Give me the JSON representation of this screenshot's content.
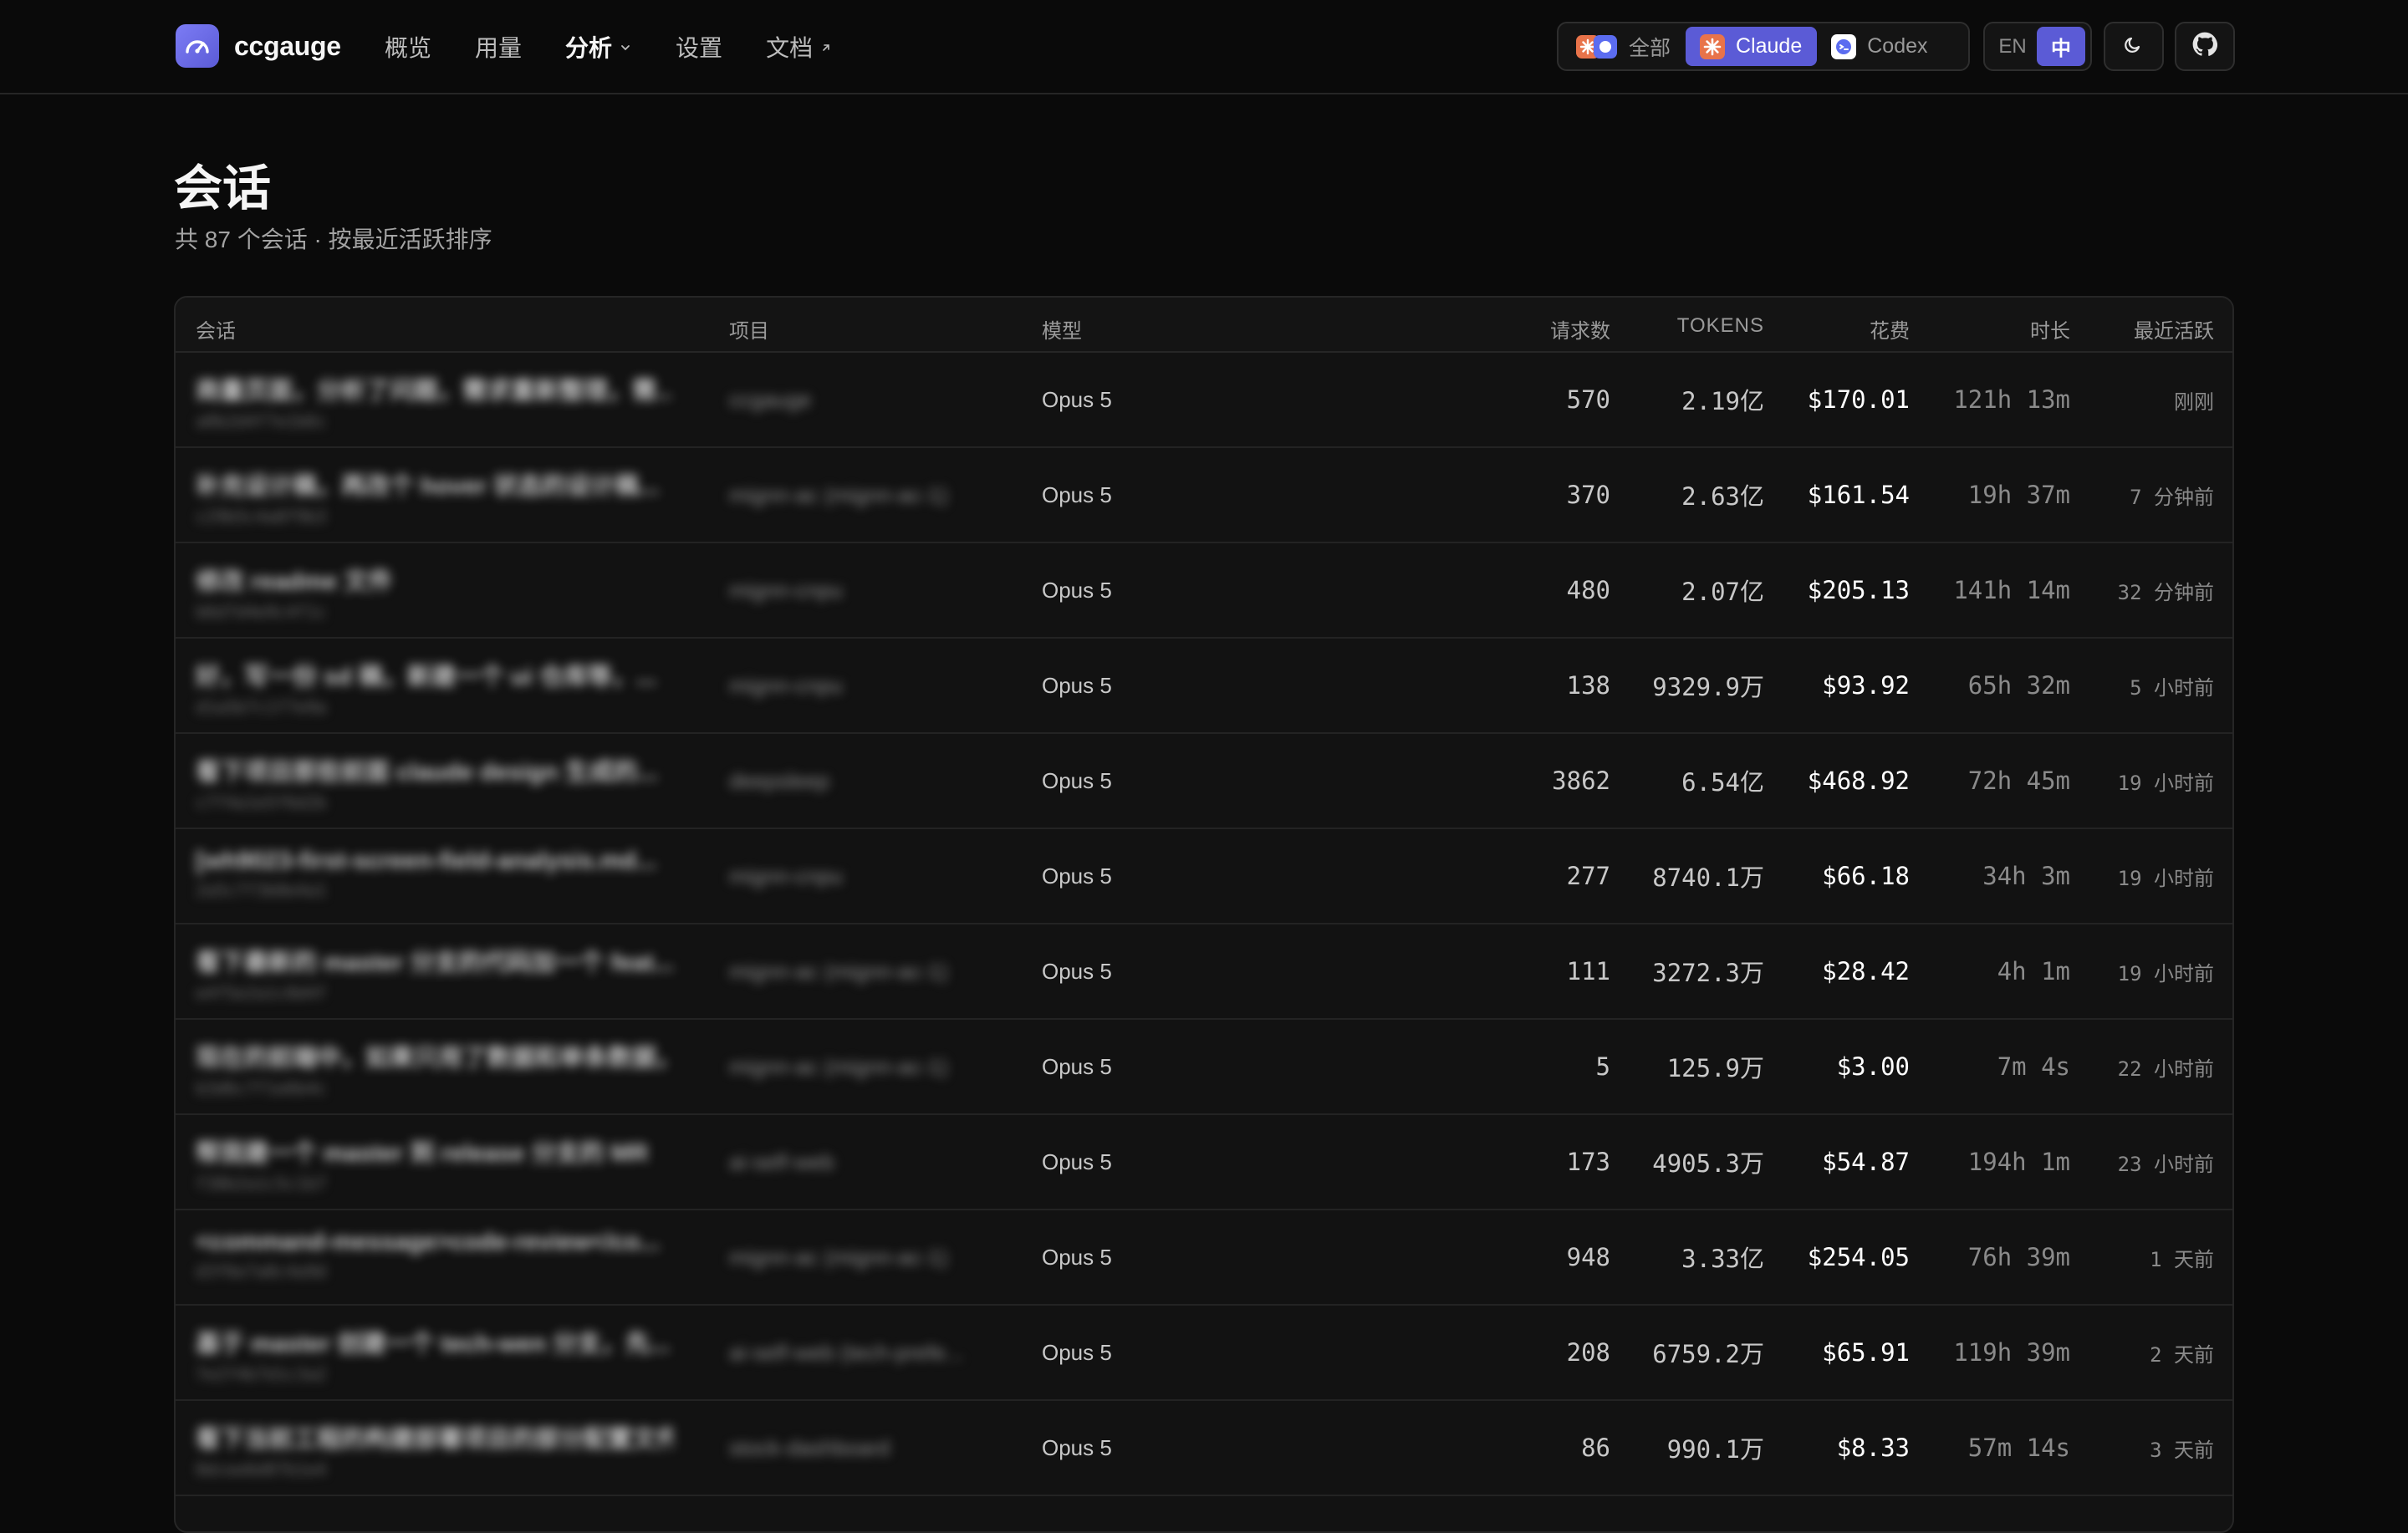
{
  "brand": {
    "name": "ccgauge"
  },
  "nav": {
    "overview": "概览",
    "usage": "用量",
    "analysis": "分析",
    "settings": "设置",
    "docs": "文档"
  },
  "source_switch": {
    "all": "全部",
    "claude": "Claude",
    "codex": "Codex",
    "selected": "Claude"
  },
  "language": {
    "en": "EN",
    "zh": "中",
    "selected": "中"
  },
  "colors": {
    "accent": "#5b5bd6",
    "background": "#0a0a0a"
  },
  "page": {
    "title": "会话",
    "subtitle": "共 87 个会话 · 按最近活跃排序"
  },
  "table": {
    "columns": {
      "session": "会话",
      "project": "项目",
      "model": "模型",
      "requests": "请求数",
      "tokens": "TOKENS",
      "cost": "花费",
      "duration": "时长",
      "last_active": "最近活跃"
    },
    "rows": [
      {
        "session": "商量页面，分析了问题，需求重新整理，需...",
        "id": "a0b2d4f7e1b6c",
        "project": "ccgauge",
        "model": "Opus 5",
        "requests": "570",
        "tokens": "2.19亿",
        "cost": "$170.01",
        "duration": "121h 13m",
        "last_active": "刚刚"
      },
      {
        "session": "补充设计稿，再改个 hover 状态的设计稿...",
        "id": "c29b5c4a8f9b3",
        "project": "mignn-ac (mignn-ac-1)",
        "model": "Opus 5",
        "requests": "370",
        "tokens": "2.63亿",
        "cost": "$161.54",
        "duration": "19h 37m",
        "last_active": "7 分钟前"
      },
      {
        "session": "修改 readme 文件",
        "id": "b6d7d4e9c4f1c",
        "project": "mignn-cnpu",
        "model": "Opus 5",
        "requests": "480",
        "tokens": "2.07亿",
        "cost": "$205.13",
        "duration": "141h 14m",
        "last_active": "32 分钟前"
      },
      {
        "session": "好，写一份 sd 稿，新建一个 ui 仓库等，...",
        "id": "d1a5b7c1f7e9a",
        "project": "mignn-cnpu",
        "model": "Opus 5",
        "requests": "138",
        "tokens": "9329.9万",
        "cost": "$93.92",
        "duration": "65h 32m",
        "last_active": "5 小时前"
      },
      {
        "session": "看下项目那些前面 claude design 生成的...",
        "id": "c7f4a1e5f6d2b",
        "project": "deepsleep",
        "model": "Opus 5",
        "requests": "3862",
        "tokens": "6.54亿",
        "cost": "$468.92",
        "duration": "72h 45m",
        "last_active": "19 小时前"
      },
      {
        "session": "[wh9023-first-screen-field-analysis.md...",
        "id": "2a5c7f3b8e4a1",
        "project": "mignn-cnpu",
        "model": "Opus 5",
        "requests": "277",
        "tokens": "8740.1万",
        "cost": "$66.18",
        "duration": "34h 3m",
        "last_active": "19 小时前"
      },
      {
        "session": "看下最新的 master 分支的代码加一个 feat...",
        "id": "e4f5e2a1c0d4f",
        "project": "mignn-ac (mignn-ac-1)",
        "model": "Opus 5",
        "requests": "111",
        "tokens": "3272.3万",
        "cost": "$28.42",
        "duration": "4h 1m",
        "last_active": "19 小时前"
      },
      {
        "session": "现在的前端中，如果只用了数据和单条数据，...",
        "id": "b3d6c7f1e6b4c",
        "project": "mignn-ac (mignn-ac-1)",
        "model": "Opus 5",
        "requests": "5",
        "tokens": "125.9万",
        "cost": "$3.00",
        "duration": "7m 4s",
        "last_active": "22 小时前"
      },
      {
        "session": "帮我建一个 master 到 release 分支的 MR",
        "id": "f38b2a1c5c1b7",
        "project": "ai-self-web",
        "model": "Opus 5",
        "requests": "173",
        "tokens": "4905.3万",
        "cost": "$54.87",
        "duration": "194h 1m",
        "last_active": "23 小时前"
      },
      {
        "session": "<command-message>code-review</co...",
        "id": "d3f6e7a8c4a9d",
        "project": "mignn-ac (mignn-ac-1)",
        "model": "Opus 5",
        "requests": "948",
        "tokens": "3.33亿",
        "cost": "$254.05",
        "duration": "76h 39m",
        "last_active": "1 天前"
      },
      {
        "session": "基于 master 创建一个 tech-wen 分支，先...",
        "id": "7e2f4b7d1c3a2",
        "project": "ai-self-web (tech-prefe...",
        "model": "Opus 5",
        "requests": "208",
        "tokens": "6759.2万",
        "cost": "$65.91",
        "duration": "119h 39m",
        "last_active": "2 天前"
      },
      {
        "session": "看下当前工程的构建部署项目的部分配置文件里",
        "id": "0dcee6d07b1e4",
        "project": "stock-dashboard",
        "model": "Opus 5",
        "requests": "86",
        "tokens": "990.1万",
        "cost": "$8.33",
        "duration": "57m 14s",
        "last_active": "3 天前"
      }
    ]
  }
}
